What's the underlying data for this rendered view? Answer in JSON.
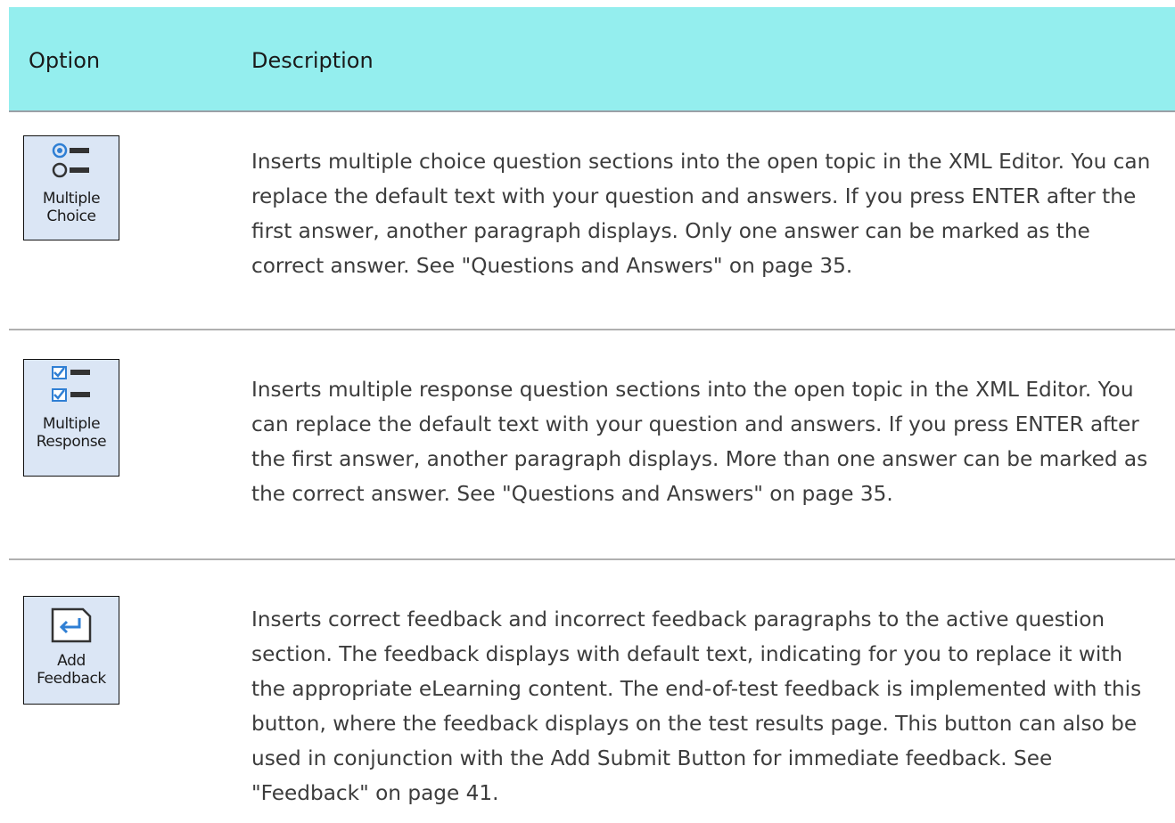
{
  "header": {
    "option": "Option",
    "description": "Description"
  },
  "rows": [
    {
      "icon": "multiple-choice-icon",
      "label_line1": "Multiple",
      "label_line2": "Choice",
      "description": "Inserts multiple choice question sections into the open topic in the XML Editor. You can replace the default text with your question and answers. If you press ENTER after the first answer, another paragraph displays. Only one answer can be marked as the correct answer. See \"Questions and Answers\" on page 35."
    },
    {
      "icon": "multiple-response-icon",
      "label_line1": "Multiple",
      "label_line2": "Response",
      "description": "Inserts multiple response question sections into the open topic in the XML Editor. You can replace the default text with your question and answers. If you press ENTER after the first answer, another paragraph displays. More than one answer can be marked as the correct answer. See \"Questions and Answers\" on page 35."
    },
    {
      "icon": "add-feedback-icon",
      "label_line1": "Add",
      "label_line2": "Feedback",
      "description": "Inserts correct feedback and incorrect feedback paragraphs to the active question section. The feedback displays with default text, indicating for you to replace it with the appropriate eLearning content. The end-of-test feedback is implemented with this button, where the feedback displays on the test results page. This button can also be used in conjunction with the Add Submit Button for immediate feedback. See \"Feedback\" on page 41."
    }
  ],
  "colors": {
    "header_bg": "#94eeee",
    "icon_bg": "#dbe6f5",
    "icon_accent": "#2f7fd4"
  }
}
